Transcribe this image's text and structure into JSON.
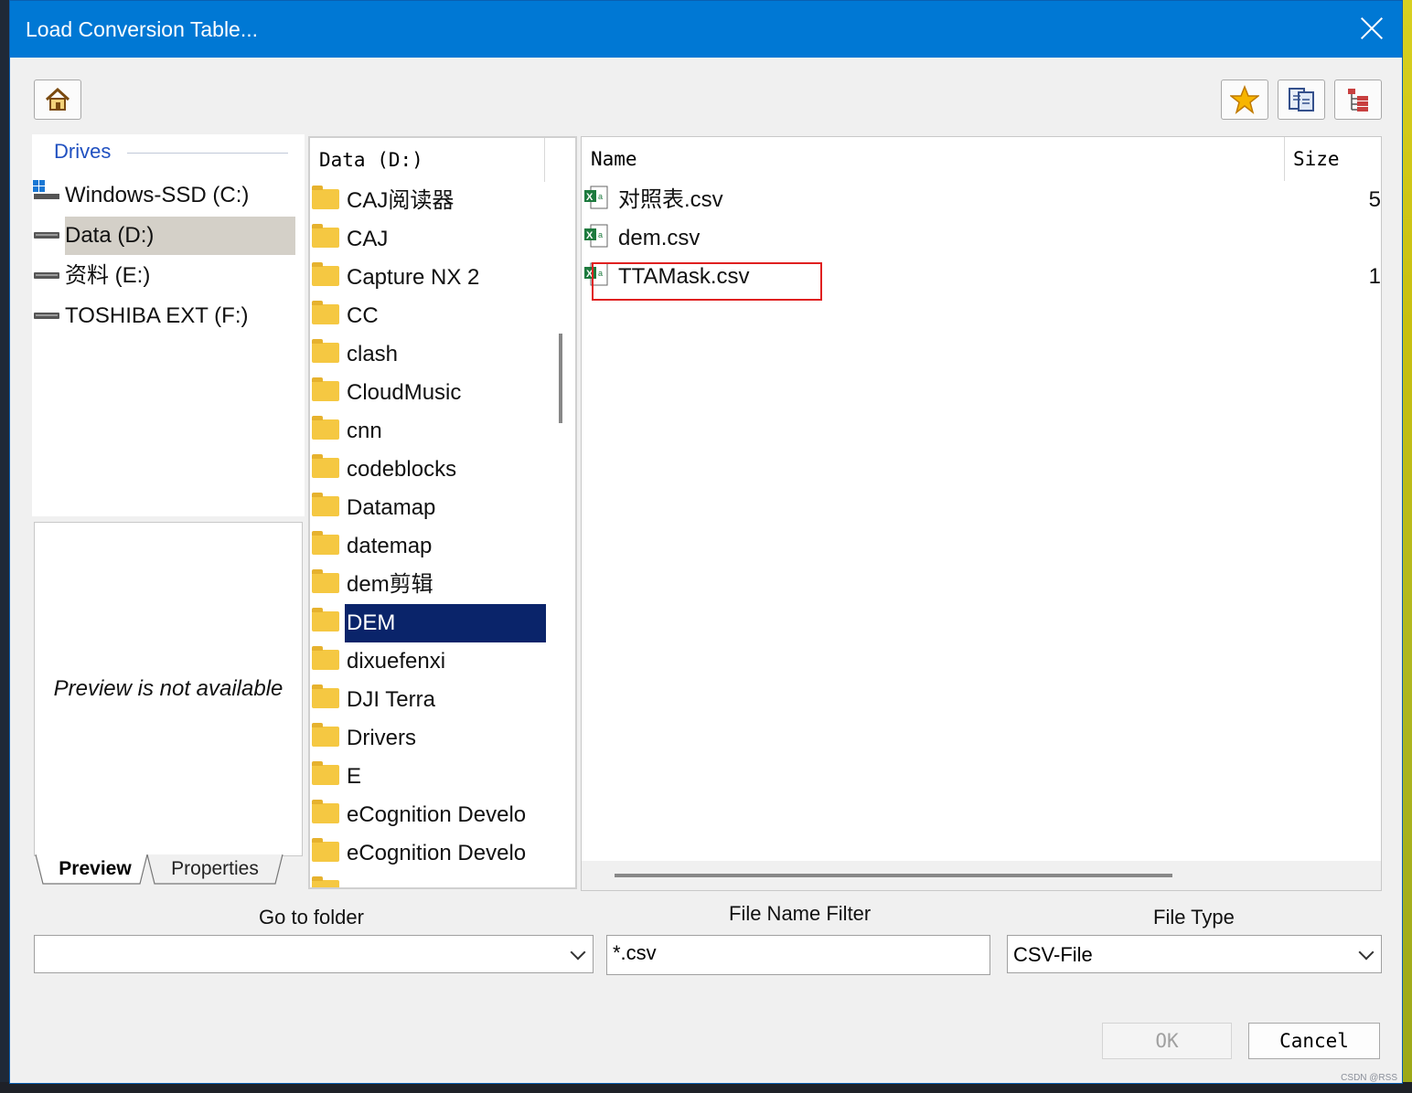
{
  "window": {
    "title": "Load Conversion Table..."
  },
  "toolbar": {
    "home": "home-icon",
    "favorites": "star-icon",
    "sync": "refresh-icon",
    "tree": "tree-view-icon"
  },
  "drives": {
    "header": "Drives",
    "items": [
      {
        "label": "Windows-SSD (C:)",
        "selected": false
      },
      {
        "label": "Data (D:)",
        "selected": true
      },
      {
        "label": "资料 (E:)",
        "selected": false
      },
      {
        "label": "TOSHIBA EXT (F:)",
        "selected": false
      }
    ]
  },
  "preview": {
    "message": "Preview is not available",
    "tabs": [
      "Preview",
      "Properties"
    ]
  },
  "folders": {
    "header": "Data (D:)",
    "items": [
      "CAJ阅读器",
      "CAJ",
      "Capture NX 2",
      "CC",
      "clash",
      "CloudMusic",
      "cnn",
      "codeblocks",
      "Datamap",
      "datemap",
      "dem剪辑",
      "DEM",
      "dixuefenxi",
      "DJI Terra",
      "Drivers",
      "E",
      "eCognition Develo",
      "eCognition Develo"
    ],
    "selected": "DEM"
  },
  "files": {
    "columns": {
      "name": "Name",
      "size": "Size"
    },
    "items": [
      {
        "name": "对照表.csv",
        "size": "5"
      },
      {
        "name": "dem.csv",
        "size": ""
      },
      {
        "name": "TTAMask.csv",
        "size": "1"
      }
    ]
  },
  "bottom": {
    "go_to_folder_label": "Go to folder",
    "go_to_folder_value": "",
    "filter_label": "File Name Filter",
    "filter_value": "*.csv",
    "file_type_label": "File Type",
    "file_type_value": "CSV-File"
  },
  "buttons": {
    "ok": "OK",
    "cancel": "Cancel"
  },
  "watermark": "CSDN @RSS"
}
